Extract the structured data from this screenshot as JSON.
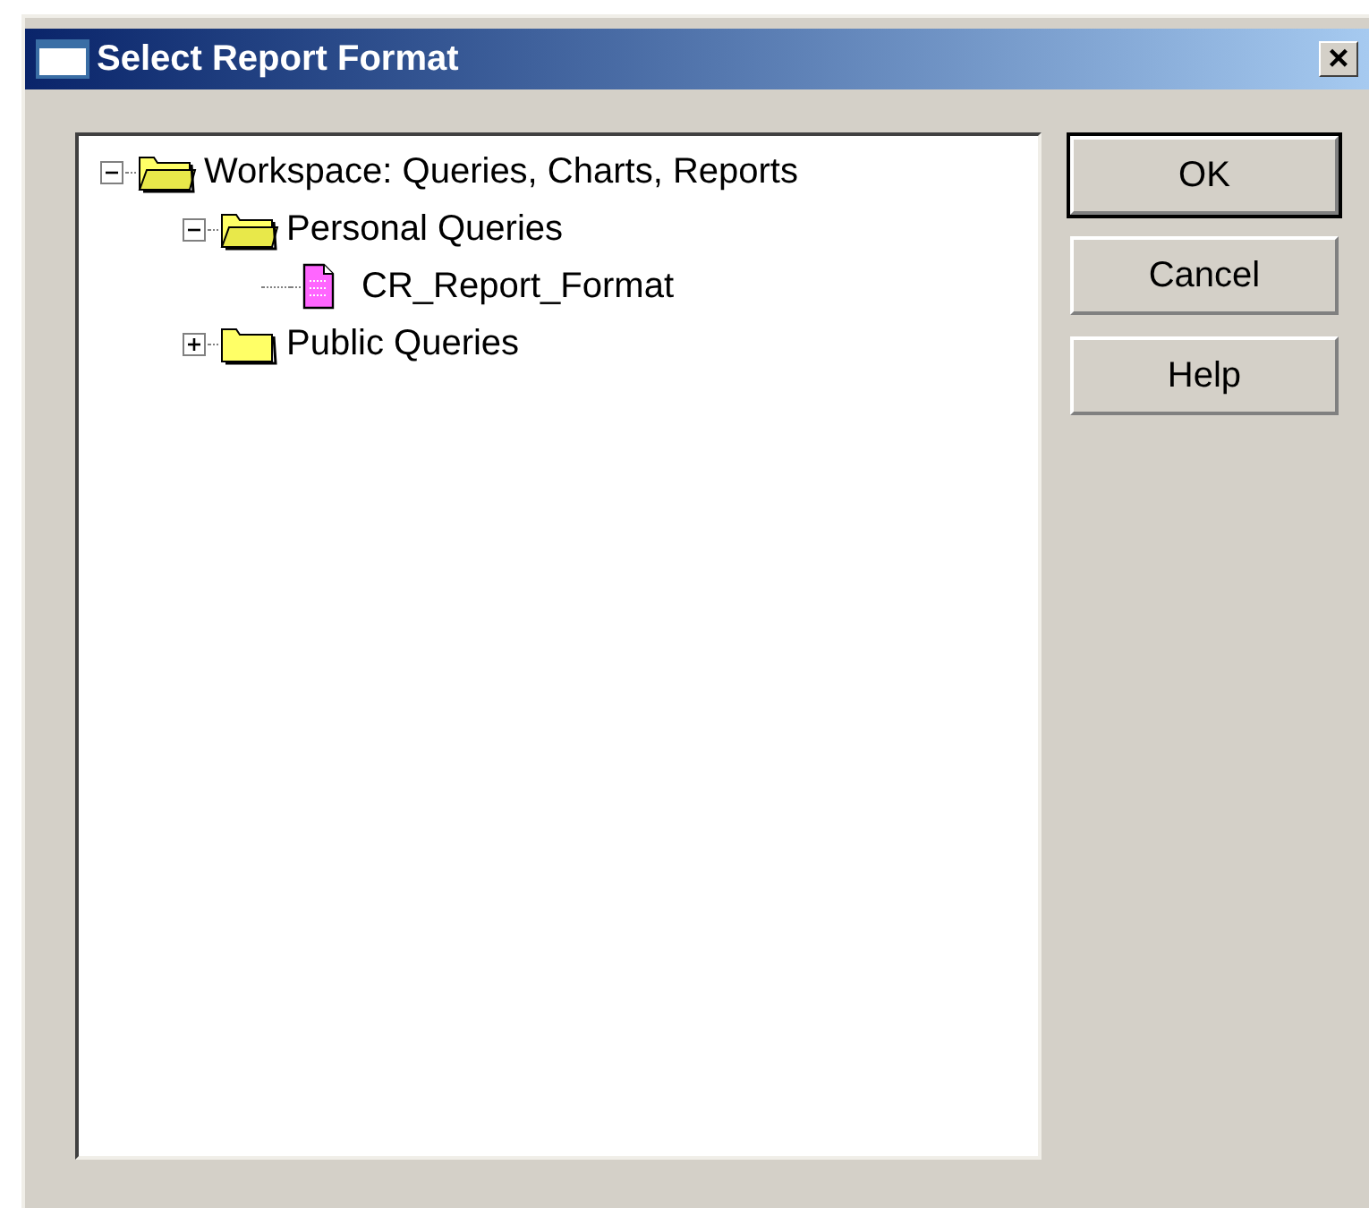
{
  "window": {
    "title": "Select Report Format",
    "close": "×"
  },
  "tree": [
    {
      "label": "Workspace: Queries, Charts, Reports",
      "kind": "folder",
      "expanded": true,
      "children": [
        {
          "label": "Personal Queries",
          "kind": "folder",
          "expanded": true,
          "children": [
            {
              "label": "CR_Report_Format",
              "kind": "report"
            }
          ]
        },
        {
          "label": "Public Queries",
          "kind": "folder",
          "expanded": false
        }
      ]
    }
  ],
  "buttons": [
    {
      "label": "OK",
      "default": true
    },
    {
      "label": "Cancel",
      "default": false
    },
    {
      "label": "Help",
      "default": false
    }
  ]
}
